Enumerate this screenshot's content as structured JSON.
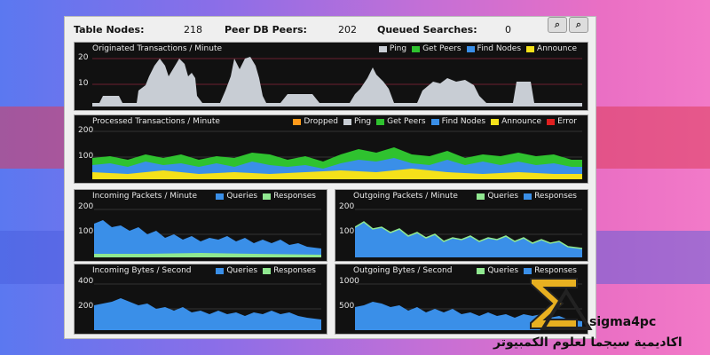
{
  "stats": {
    "table_nodes_label": "Table Nodes:",
    "table_nodes_value": "218",
    "peer_db_label": "Peer DB Peers:",
    "peer_db_value": "202",
    "queued_label": "Queued Searches:",
    "queued_value": "0"
  },
  "colors": {
    "ping": "#c8cdd4",
    "get_peers": "#2fc22f",
    "find_nodes": "#3a8fe8",
    "announce": "#f5e11a",
    "dropped": "#ff9a1a",
    "error": "#e02020",
    "queries": "#3a8fe8",
    "responses": "#90e890"
  },
  "panels": {
    "originated": {
      "title": "Originated Transactions / Minute",
      "legend": [
        "Ping",
        "Get Peers",
        "Find Nodes",
        "Announce"
      ],
      "y_ticks": [
        "20",
        "10"
      ]
    },
    "processed": {
      "title": "Processed Transactions / Minute",
      "legend": [
        "Dropped",
        "Ping",
        "Get Peers",
        "Find Nodes",
        "Announce",
        "Error"
      ],
      "y_ticks": [
        "200",
        "100"
      ]
    },
    "incoming_packets": {
      "title": "Incoming Packets / Minute",
      "legend": [
        "Queries",
        "Responses"
      ],
      "y_ticks": [
        "200",
        "100"
      ]
    },
    "outgoing_packets": {
      "title": "Outgoing Packets / Minute",
      "legend": [
        "Queries",
        "Responses"
      ],
      "y_ticks": [
        "200",
        "100"
      ]
    },
    "incoming_bytes": {
      "title": "Incoming Bytes / Second",
      "legend": [
        "Queries",
        "Responses"
      ],
      "y_ticks": [
        "400",
        "200"
      ]
    },
    "outgoing_bytes": {
      "title": "Outgoing Bytes / Second",
      "legend": [
        "Queries",
        "Responses"
      ],
      "y_ticks": [
        "1000",
        "500"
      ]
    }
  },
  "watermark": {
    "brand": "sigma4pc",
    "arabic": "اكاديمية سيجما لعلوم الكمبيوتر"
  }
}
